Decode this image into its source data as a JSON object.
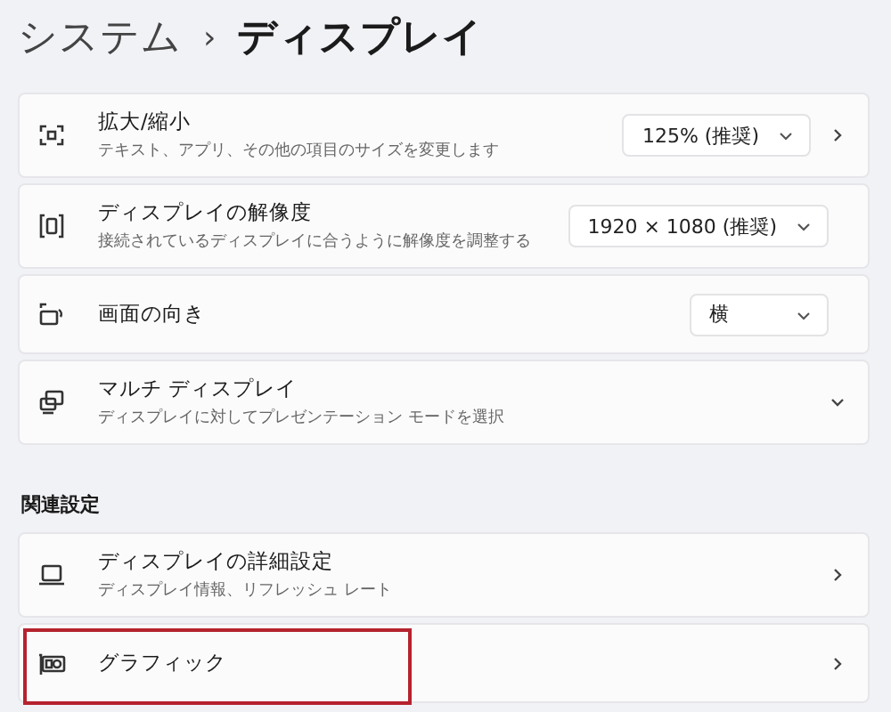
{
  "breadcrumb": {
    "parent": "システム",
    "separator": "›",
    "current": "ディスプレイ"
  },
  "sections": [
    {
      "items": [
        {
          "kind": "zoom",
          "title": "拡大/縮小",
          "description": "テキスト、アプリ、その他の項目のサイズを変更します",
          "dropdown": "125% (推奨)",
          "navigable": true,
          "highlighted": false
        },
        {
          "kind": "resolution",
          "title": "ディスプレイの解像度",
          "description": "接続されているディスプレイに合うように解像度を調整する",
          "dropdown": "1920 × 1080 (推奨)",
          "highlighted": false
        },
        {
          "kind": "rotate",
          "title": "画面の向き",
          "dropdown": "横",
          "highlighted": false
        },
        {
          "kind": "multi",
          "title": "マルチ ディスプレイ",
          "description": "ディスプレイに対してプレゼンテーション モードを選択",
          "expandable": true,
          "expanded": false,
          "highlighted": false
        }
      ]
    },
    {
      "heading": "関連設定",
      "items": [
        {
          "kind": "laptop",
          "title": "ディスプレイの詳細設定",
          "description": "ディスプレイ情報、リフレッシュ レート",
          "navigable": true,
          "highlighted": false
        },
        {
          "kind": "gpu",
          "title": "グラフィック",
          "navigable": true,
          "highlighted": true
        }
      ]
    }
  ]
}
